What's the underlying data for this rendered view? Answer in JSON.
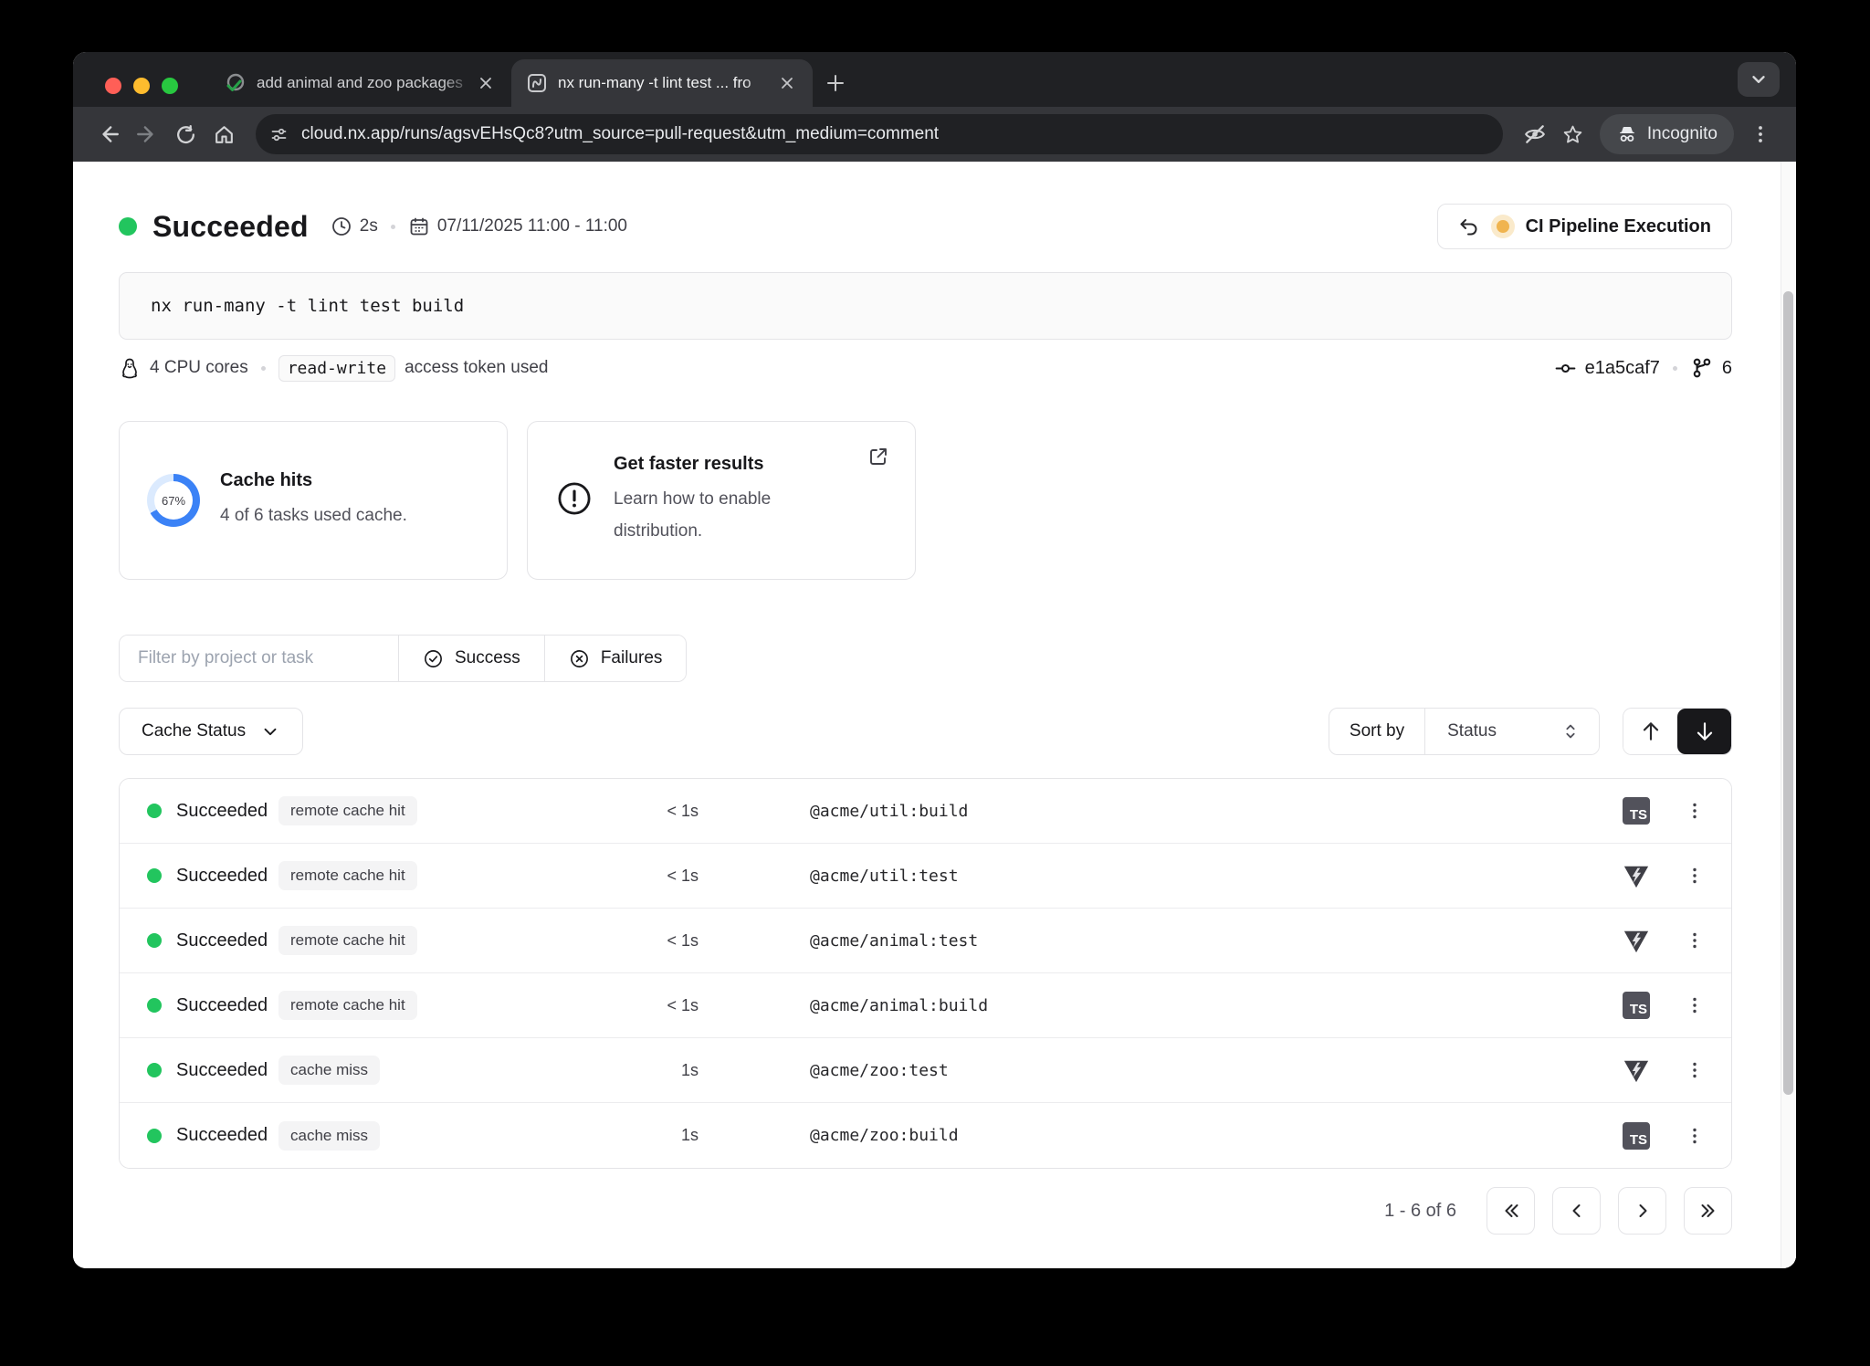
{
  "browser": {
    "tabs": [
      {
        "label": "add animal and zoo packages",
        "favicon": "github-pr-check-icon"
      },
      {
        "label": "nx run-many -t lint test ... fro",
        "favicon": "nx-cloud-icon"
      }
    ],
    "url": "cloud.nx.app/runs/agsvEHsQc8?utm_source=pull-request&utm_medium=comment",
    "incognito_label": "Incognito"
  },
  "header": {
    "status": "Succeeded",
    "duration": "2s",
    "date_range": "07/11/2025 11:00 - 11:00",
    "pipeline_button_label": "CI Pipeline Execution"
  },
  "command": "nx run-many -t lint test build",
  "meta": {
    "cpu": "4 CPU cores",
    "token_scope": "read-write",
    "token_suffix": "access token used",
    "commit": "e1a5caf7",
    "branch_count": "6"
  },
  "cards": {
    "cache": {
      "percent": "67%",
      "percent_value": 67,
      "title": "Cache hits",
      "subtitle": "4 of 6 tasks used cache."
    },
    "distribution": {
      "title": "Get faster results",
      "subtitle_line1": "Learn how to enable",
      "subtitle_line2": "distribution."
    }
  },
  "filters": {
    "placeholder": "Filter by project or task",
    "success_label": "Success",
    "failures_label": "Failures",
    "cache_status_label": "Cache Status",
    "sort_by_label": "Sort by",
    "sort_value": "Status"
  },
  "table": {
    "rows": [
      {
        "status": "Succeeded",
        "cache_status": "remote cache hit",
        "duration": "< 1s",
        "task": "@acme/util:build",
        "tool": "ts"
      },
      {
        "status": "Succeeded",
        "cache_status": "remote cache hit",
        "duration": "< 1s",
        "task": "@acme/util:test",
        "tool": "vitest"
      },
      {
        "status": "Succeeded",
        "cache_status": "remote cache hit",
        "duration": "< 1s",
        "task": "@acme/animal:test",
        "tool": "vitest"
      },
      {
        "status": "Succeeded",
        "cache_status": "remote cache hit",
        "duration": "< 1s",
        "task": "@acme/animal:build",
        "tool": "ts"
      },
      {
        "status": "Succeeded",
        "cache_status": "cache miss",
        "duration": "1s",
        "task": "@acme/zoo:test",
        "tool": "vitest"
      },
      {
        "status": "Succeeded",
        "cache_status": "cache miss",
        "duration": "1s",
        "task": "@acme/zoo:build",
        "tool": "ts"
      }
    ]
  },
  "pagination": {
    "range_label": "1 - 6 of 6"
  },
  "colors": {
    "accent_blue": "#3b82f6",
    "ring_track": "#dbeafe",
    "success_green": "#22c55e",
    "warning_amber": "#f0b44f",
    "traffic_red": "#ff5f57",
    "traffic_yellow": "#febc2e",
    "traffic_green": "#28c840"
  }
}
